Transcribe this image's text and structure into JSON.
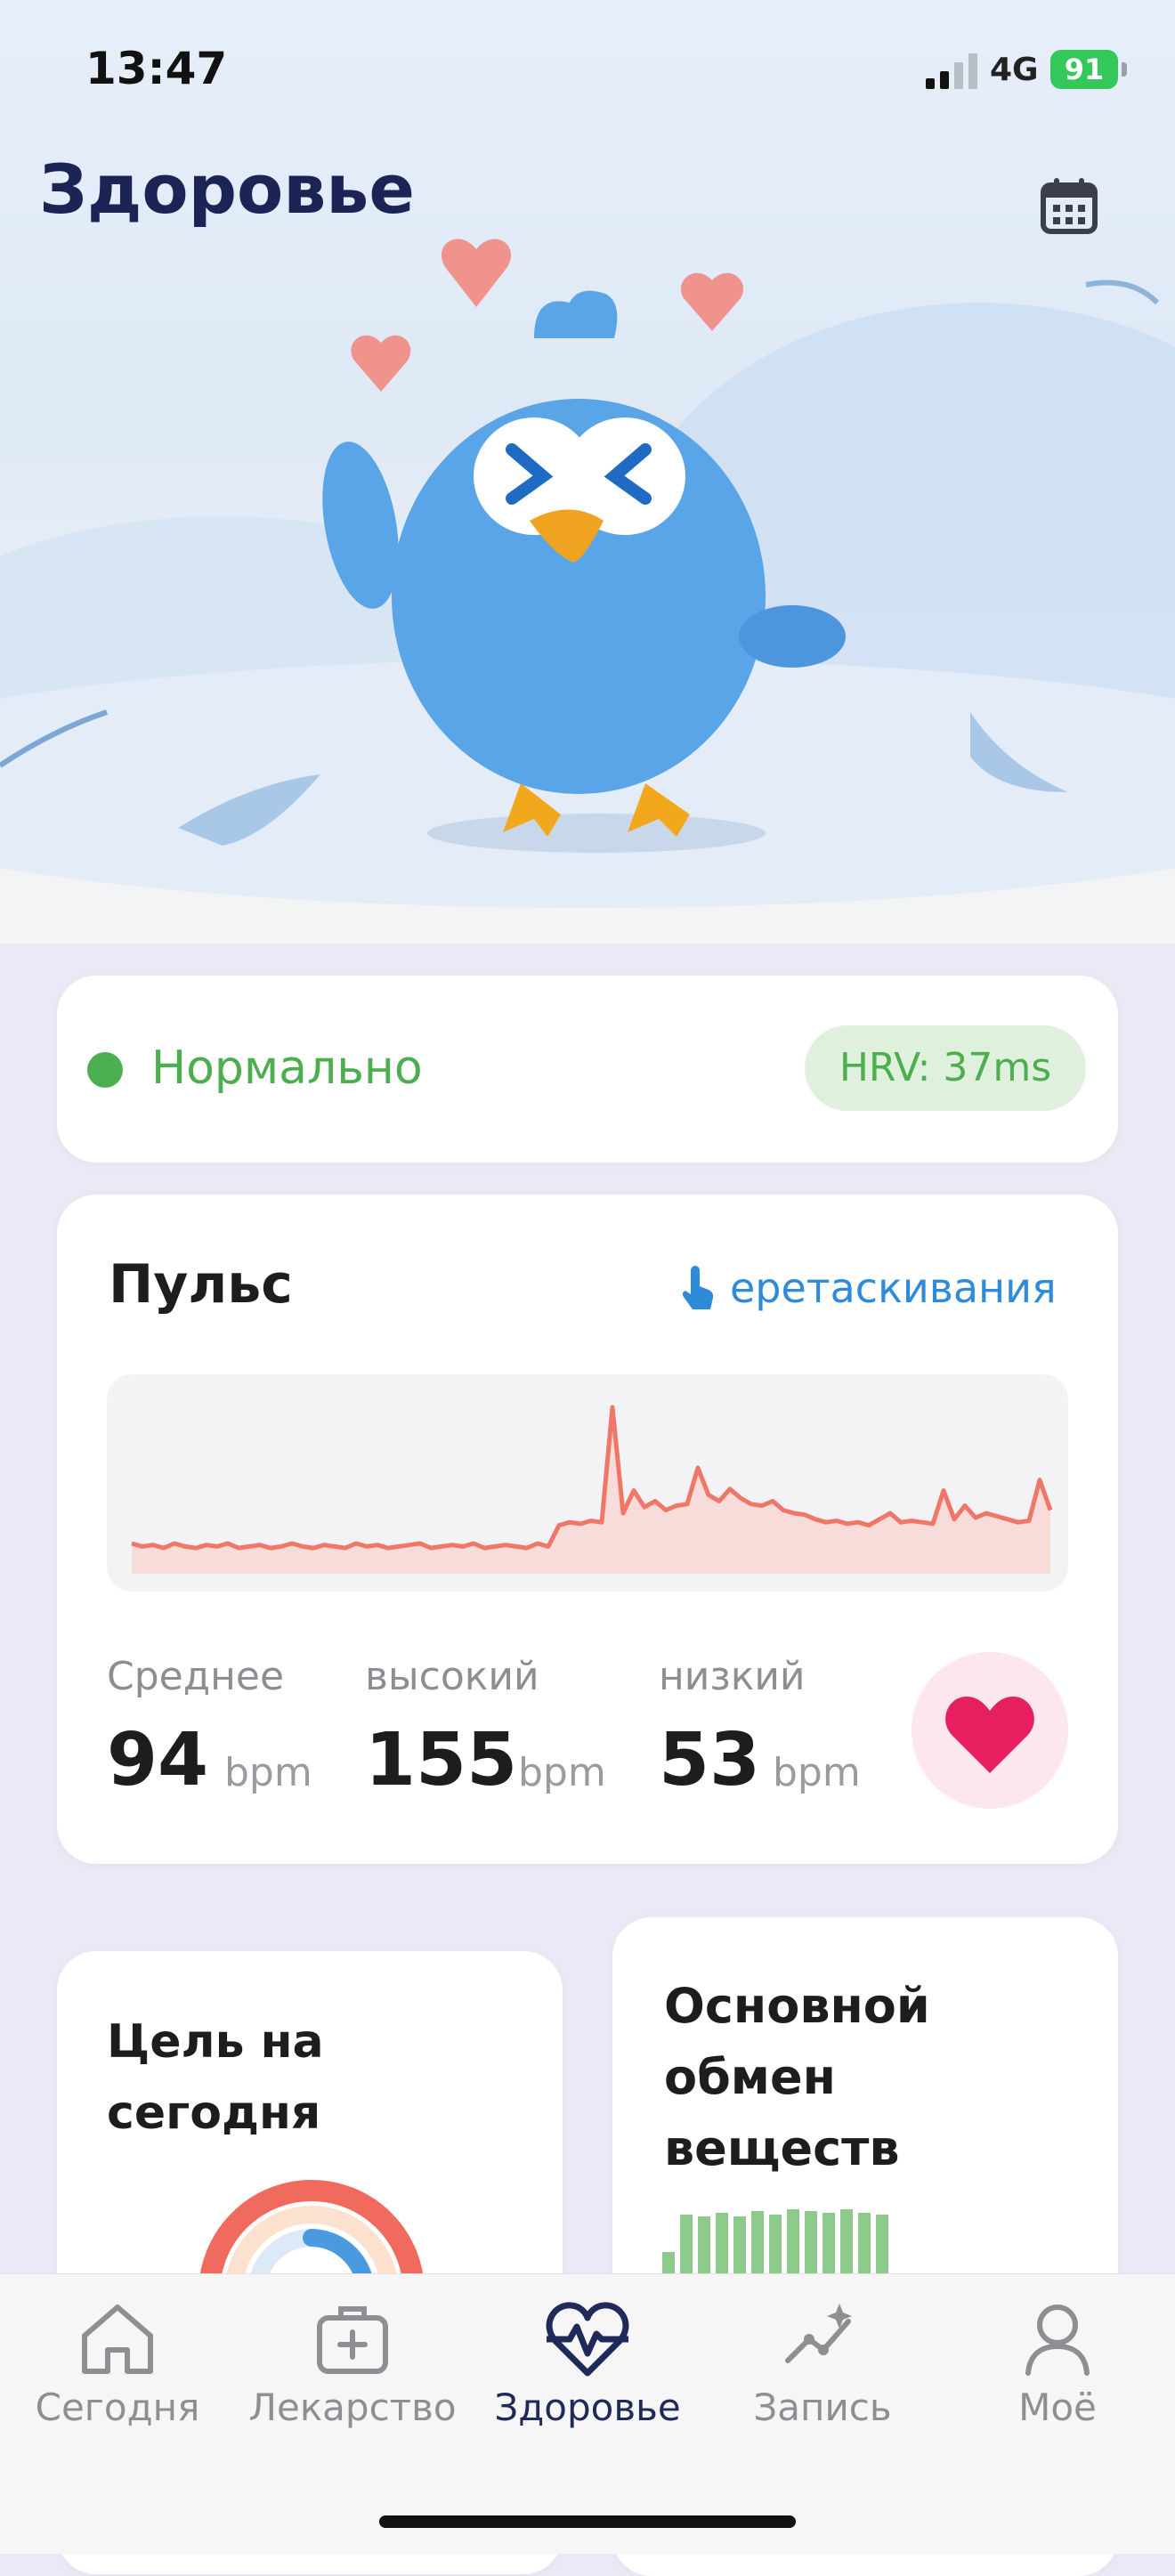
{
  "status_bar": {
    "time": "13:47",
    "network": "4G",
    "battery": "91"
  },
  "header": {
    "title": "Здоровье",
    "calendar_icon": "calendar-icon"
  },
  "status_card": {
    "text": "Нормально",
    "hrv": "HRV: 37ms",
    "color": "#4cae4f"
  },
  "pulse": {
    "title": "Пульс",
    "drag_hint": "еретаскивания",
    "stats": [
      {
        "label": "Среднее",
        "value": "94",
        "unit": "bpm"
      },
      {
        "label": "высокий",
        "value": "155",
        "unit": "bpm"
      },
      {
        "label": "низкий",
        "value": "53",
        "unit": "bpm"
      }
    ],
    "line_color": "#ef7767"
  },
  "chart_data": {
    "type": "area",
    "series": [
      {
        "values": [
          60,
          58,
          59,
          57,
          60,
          58,
          57,
          59,
          58,
          60,
          57,
          58,
          59,
          57,
          58,
          60,
          58,
          57,
          59,
          58,
          57,
          60,
          58,
          59,
          57,
          58,
          59,
          60,
          57,
          58,
          59,
          58,
          60,
          57,
          58,
          59,
          58,
          57,
          60,
          58,
          72,
          74,
          73,
          75,
          74,
          150,
          80,
          95,
          84,
          88,
          82,
          85,
          86,
          110,
          92,
          88,
          96,
          90,
          86,
          85,
          88,
          82,
          80,
          79,
          76,
          74,
          75,
          73,
          74,
          72,
          76,
          80,
          74,
          75,
          74,
          73,
          95,
          76,
          85,
          77,
          80,
          78,
          76,
          74,
          75,
          102,
          82
        ]
      }
    ]
  },
  "goal_card": {
    "title": "Цель на сегодня"
  },
  "bmr_card": {
    "title": "Основной обмен веществ"
  },
  "tabs": [
    {
      "label": "Сегодня",
      "icon": "home-icon",
      "active": false
    },
    {
      "label": "Лекарство",
      "icon": "medicine-kit-icon",
      "active": false
    },
    {
      "label": "Здоровье",
      "icon": "heart-pulse-icon",
      "active": true
    },
    {
      "label": "Запись",
      "icon": "sparkle-trend-icon",
      "active": false
    },
    {
      "label": "Моё",
      "icon": "profile-icon",
      "active": false
    }
  ]
}
